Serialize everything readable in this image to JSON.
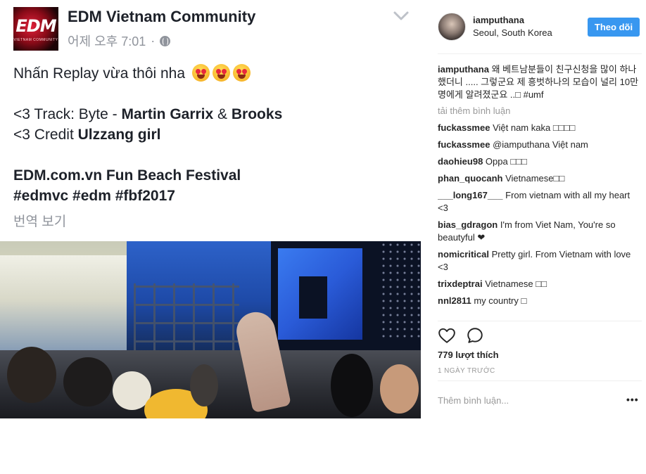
{
  "facebook_post": {
    "page_name": "EDM Vietnam Community",
    "logo_text": "EDM",
    "logo_subtext": "VIETNAM COMMUNITY",
    "timestamp": "어제 오후 7:01",
    "separator": "·",
    "body": {
      "line1": "Nhấn Replay vừa thôi nha",
      "track_prefix": "<3 Track: Byte - ",
      "track_artist1": "Martin Garrix",
      "track_amp": " & ",
      "track_artist2": "Brooks",
      "credit_prefix": "<3 Credit ",
      "credit_name": "Ulzzang girl",
      "event": "EDM.com.vn Fun Beach Festival",
      "hashtags": "#edmvc #edm #fbf2017"
    },
    "translate_label": "번역 보기"
  },
  "instagram": {
    "username": "iamputhana",
    "location": "Seoul, South Korea",
    "follow_label": "Theo dõi",
    "caption": {
      "user": "iamputhana",
      "text": " 왜 베트남분들이 친구신청을 많이 하나했더니 ..... 그렇군요 제 흥벗하나의 모습이 널리 10만명에게 알려졌군요 ..□ #umf"
    },
    "load_more": "tải thêm bình luận",
    "comments": [
      {
        "user": "fuckassmee",
        "text": " Việt nam kaka □□□□"
      },
      {
        "user": "fuckassmee",
        "text": " @iamputhana Việt nam"
      },
      {
        "user": "daohieu98",
        "text": " Oppa □□□"
      },
      {
        "user": "phan_quocanh",
        "text": " Vietnamese□□"
      },
      {
        "user": "___long167___",
        "text": " From vietnam with all my heart <3"
      },
      {
        "user": "bias_gdragon",
        "text": " I'm from Viet Nam, You're so beautyful ❤"
      },
      {
        "user": "nomicritical",
        "text": " Pretty girl. From Vietnam with love <3"
      },
      {
        "user": "trixdeptrai",
        "text": " Vietnamese □□"
      },
      {
        "user": "nnl2811",
        "text": " my country □"
      }
    ],
    "likes": "779 lượt thích",
    "time_ago": "1 NGÀY TRƯỚC",
    "add_comment_placeholder": "Thêm bình luận...",
    "options_label": "•••"
  },
  "icons": {
    "globe": "globe-icon",
    "chevron": "chevron-down-icon",
    "like": "heart-icon",
    "comment": "comment-icon",
    "emoji": "heart-eyes-emoji"
  },
  "colors": {
    "follow_button": "#3897f0",
    "muted_text": "#90949c",
    "ig_muted": "#999999"
  }
}
